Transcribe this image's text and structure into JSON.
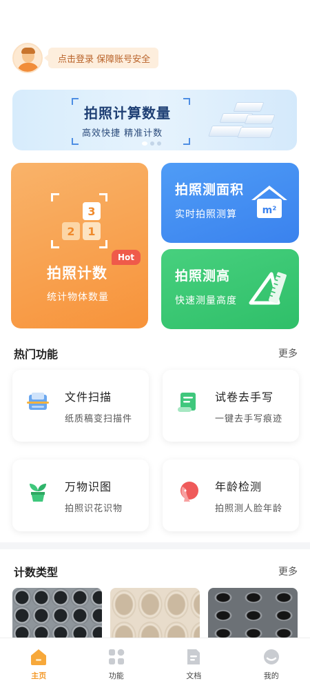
{
  "login": {
    "prompt": "点击登录 保障账号安全"
  },
  "banner": {
    "title": "拍照计算数量",
    "subtitle": "高效快捷 精准计数"
  },
  "cards": {
    "count": {
      "title": "拍照计数",
      "subtitle": "统计物体数量",
      "badge": "Hot",
      "digits": [
        "3",
        "2",
        "1"
      ]
    },
    "area": {
      "title": "拍照测面积",
      "subtitle": "实时拍照测算",
      "icon_text": "m²"
    },
    "height": {
      "title": "拍照测高",
      "subtitle": "快速测量高度"
    }
  },
  "hot": {
    "title": "热门功能",
    "more": "更多",
    "items": [
      {
        "title": "文件扫描",
        "subtitle": "纸质稿变扫描件",
        "icon": "scan-icon"
      },
      {
        "title": "试卷去手写",
        "subtitle": "一键去手写痕迹",
        "icon": "exam-icon"
      },
      {
        "title": "万物识图",
        "subtitle": "拍照识花识物",
        "icon": "plant-icon"
      },
      {
        "title": "年龄检测",
        "subtitle": "拍照测人脸年龄",
        "icon": "face-icon"
      }
    ]
  },
  "types": {
    "title": "计数类型",
    "more": "更多"
  },
  "tabs": [
    {
      "label": "主页",
      "icon": "home-icon",
      "active": true
    },
    {
      "label": "功能",
      "icon": "grid-icon",
      "active": false
    },
    {
      "label": "文档",
      "icon": "document-icon",
      "active": false
    },
    {
      "label": "我的",
      "icon": "profile-icon",
      "active": false
    }
  ],
  "colors": {
    "accent_orange": "#f7933a",
    "accent_blue": "#3a82ee",
    "accent_green": "#2fbf69",
    "tab_active": "#f49a2b"
  }
}
